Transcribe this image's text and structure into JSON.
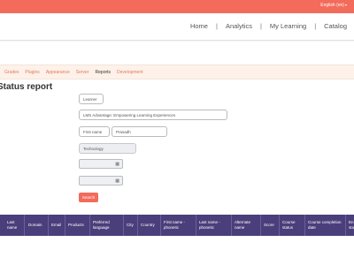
{
  "topbar": {
    "language": "English (en)",
    "caret": "▾"
  },
  "nav": {
    "items": [
      "Home",
      "Analytics",
      "My Learning",
      "Catalog"
    ],
    "separator": "|"
  },
  "tabs": {
    "items": [
      "Grades",
      "Plugins",
      "Appearance",
      "Server",
      "Reports",
      "Development"
    ],
    "active": "Reports"
  },
  "page": {
    "title": "Status report"
  },
  "filters": {
    "learner": "Learner",
    "course": "LMS Advantage: Empowering Learning Experiences",
    "first_name_label": "First name",
    "first_name_value": "Prasadh",
    "category": "Technology",
    "calendar_icon": "▦",
    "search_label": "Search"
  },
  "table": {
    "headers": [
      "Last name",
      "Domain",
      "Email",
      "Products",
      "Preferred language",
      "City",
      "Country",
      "First name - phonetic",
      "Last name - phonetic",
      "Alternate name",
      "Score",
      "Course status",
      "Course completion date",
      "En sta"
    ]
  },
  "colors": {
    "accent": "#f26b5b",
    "table_header": "#4a3f7a",
    "tab_bar": "#fdf1e9"
  }
}
